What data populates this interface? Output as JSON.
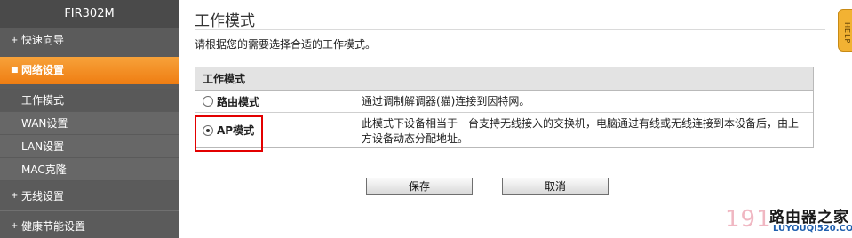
{
  "sidebar": {
    "model": "FIR302M",
    "menu": [
      {
        "label": "快速向导"
      },
      {
        "label": "网络设置"
      },
      {
        "label": "无线设置"
      },
      {
        "label": "健康节能设置"
      }
    ],
    "sub": [
      {
        "label": "工作模式"
      },
      {
        "label": "WAN设置"
      },
      {
        "label": "LAN设置"
      },
      {
        "label": "MAC克隆"
      }
    ]
  },
  "main": {
    "title": "工作模式",
    "description": "请根据您的需要选择合适的工作模式。",
    "table": {
      "header": "工作模式",
      "rows": [
        {
          "mode": "路由模式",
          "desc": "通过调制解调器(猫)连接到因特网。",
          "checked": false
        },
        {
          "mode": "AP模式",
          "desc": "此模式下设备相当于一台支持无线接入的交换机，电脑通过有线或无线连接到本设备后，由上方设备动态分配地址。",
          "checked": true
        }
      ]
    },
    "buttons": {
      "save": "保存",
      "cancel": "取消"
    }
  },
  "help_tab": "HELP",
  "watermark": {
    "number": "191",
    "logo": "路由器之家",
    "site": "LUYOUQI520.COM"
  },
  "colors": {
    "sidebar_bg": "#5b5b5b",
    "active_menu": "#f08a1e",
    "highlight_border": "#e30000",
    "help_tab": "#f2b233"
  },
  "icons": {
    "menu_bullet": "bullet-icon",
    "help": "help-tab-icon"
  }
}
